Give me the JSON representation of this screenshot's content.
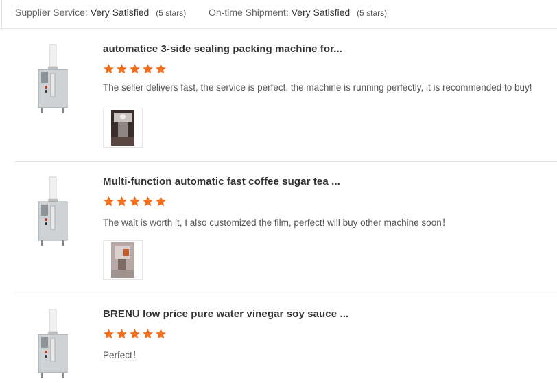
{
  "summary": {
    "supplier_service_label": "Supplier Service:",
    "supplier_service_value": "Very Satisfied",
    "supplier_service_stars": "(5 stars)",
    "shipment_label": "On-time Shipment:",
    "shipment_value": "Very Satisfied",
    "shipment_stars": "(5 stars)"
  },
  "colors": {
    "star": "#f26f1d",
    "divider": "#e2e2e2"
  },
  "reviews": [
    {
      "title": "automatice 3-side sealing packing machine for...",
      "rating": 5,
      "comment": "The seller delivers fast, the service is perfect, the machine is running perfectly, it is recommended to buy!",
      "has_photo": true
    },
    {
      "title": "Multi-function automatic fast coffee sugar tea ...",
      "rating": 5,
      "comment": "The wait is worth it, I also customized the film, perfect! will buy other machine soon！",
      "has_photo": true
    },
    {
      "title": "BRENU low price pure water vinegar soy sauce ...",
      "rating": 5,
      "comment": "Perfect！",
      "has_photo": false
    }
  ]
}
